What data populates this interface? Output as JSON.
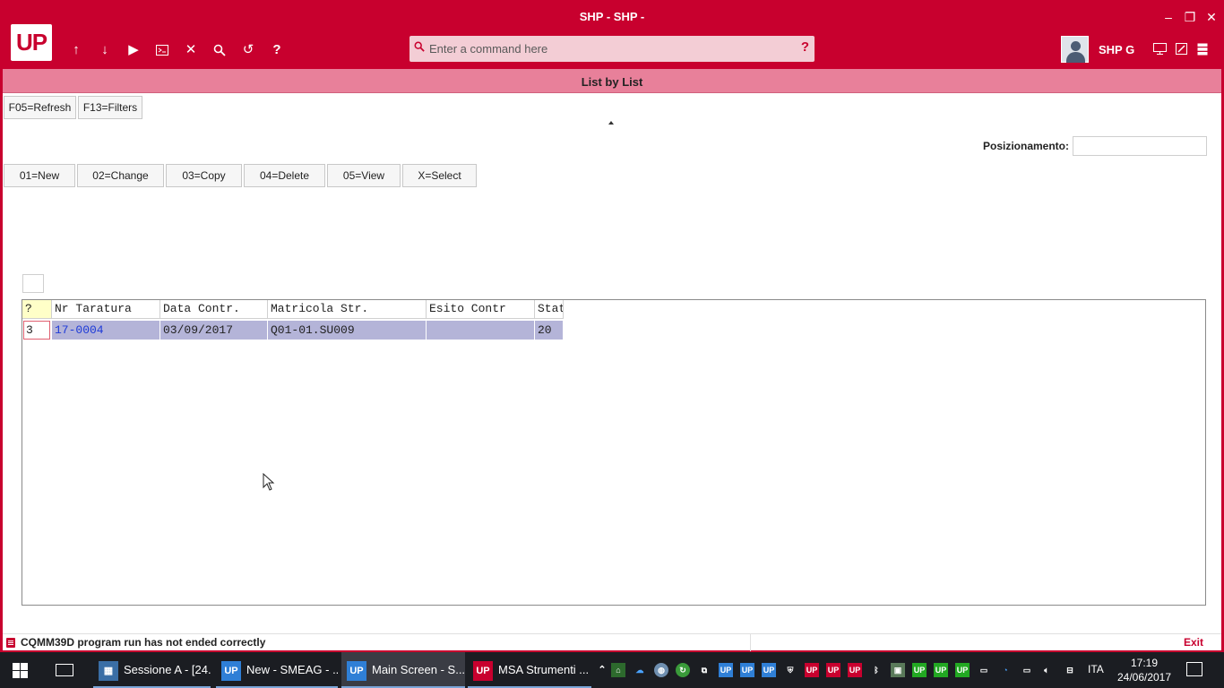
{
  "window": {
    "title": "SHP - SHP -",
    "minimize": "–",
    "restore": "❐",
    "close": "✕"
  },
  "toolbar": {
    "logo": "UP",
    "icons": [
      "arrow-up-icon",
      "arrow-down-icon",
      "play-icon",
      "terminal-icon",
      "close-icon",
      "search-icon",
      "undo-icon",
      "help-icon"
    ],
    "command_placeholder": "Enter a command here",
    "command_help": "?",
    "user": "SHP G"
  },
  "page": {
    "title": "List by List",
    "function_buttons": [
      "F05=Refresh",
      "F13=Filters"
    ],
    "positioning_label": "Posizionamento:",
    "positioning_value": "",
    "actions": [
      "01=New",
      "02=Change",
      "03=Copy",
      "04=Delete",
      "05=View",
      "X=Select"
    ]
  },
  "grid": {
    "columns": [
      "?",
      "Nr Taratura",
      "Data Contr.",
      "Matricola Str.",
      "Esito Contr",
      "Stat"
    ],
    "rows": [
      {
        "sel": "3",
        "nr": "17-0004",
        "data": "03/09/2017",
        "matricola": "Q01-01.SU009",
        "esito": "",
        "stat": "20"
      }
    ]
  },
  "status": {
    "message": "CQMM39D program run has not ended correctly",
    "exit": "Exit"
  },
  "taskbar": {
    "tasks": [
      "Sessione A - [24...",
      "New - SMEAG - ...",
      "Main Screen - S...",
      "MSA Strumenti ..."
    ],
    "language": "ITA",
    "time": "17:19",
    "date": "24/06/2017"
  },
  "colors": {
    "brand": "#c8002e",
    "header_band": "#e8809a",
    "row_highlight": "#b4b4d8",
    "link": "#1d3ad8"
  }
}
